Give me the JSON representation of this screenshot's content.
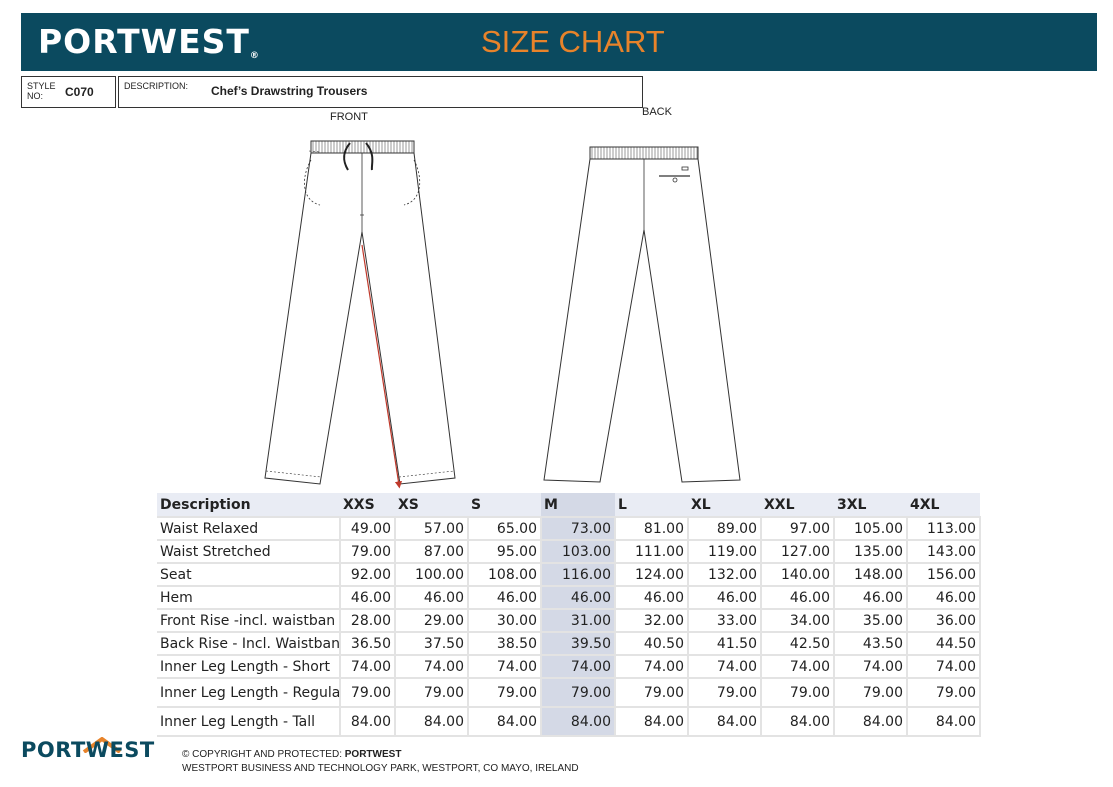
{
  "header": {
    "brand": "PORTWEST",
    "brand_mark": "®",
    "title": "SIZE CHART"
  },
  "style": {
    "label": "STYLE NO:",
    "value": "C070"
  },
  "description": {
    "label": "DESCRIPTION:",
    "value": "Chef’s Drawstring Trousers"
  },
  "views": {
    "front_label": "FRONT",
    "back_label": "BACK"
  },
  "table": {
    "headers": [
      "Description",
      "XXS",
      "XS",
      "S",
      "M",
      "L",
      "XL",
      "XXL",
      "3XL",
      "4XL"
    ],
    "rows": [
      {
        "label": "Waist Relaxed",
        "values": [
          "49.00",
          "57.00",
          "65.00",
          "73.00",
          "81.00",
          "89.00",
          "97.00",
          "105.00",
          "113.00"
        ]
      },
      {
        "label": "Waist Stretched",
        "values": [
          "79.00",
          "87.00",
          "95.00",
          "103.00",
          "111.00",
          "119.00",
          "127.00",
          "135.00",
          "143.00"
        ]
      },
      {
        "label": "Seat",
        "values": [
          "92.00",
          "100.00",
          "108.00",
          "116.00",
          "124.00",
          "132.00",
          "140.00",
          "148.00",
          "156.00"
        ]
      },
      {
        "label": "Hem",
        "values": [
          "46.00",
          "46.00",
          "46.00",
          "46.00",
          "46.00",
          "46.00",
          "46.00",
          "46.00",
          "46.00"
        ]
      },
      {
        "label": "Front Rise -incl. waistban",
        "values": [
          "28.00",
          "29.00",
          "30.00",
          "31.00",
          "32.00",
          "33.00",
          "34.00",
          "35.00",
          "36.00"
        ]
      },
      {
        "label": "Back Rise - Incl. Waistban",
        "values": [
          "36.50",
          "37.50",
          "38.50",
          "39.50",
          "40.50",
          "41.50",
          "42.50",
          "43.50",
          "44.50"
        ]
      },
      {
        "label": "Inner Leg Length - Short",
        "values": [
          "74.00",
          "74.00",
          "74.00",
          "74.00",
          "74.00",
          "74.00",
          "74.00",
          "74.00",
          "74.00"
        ]
      },
      {
        "label": "Inner Leg Length - Regula",
        "values": [
          "79.00",
          "79.00",
          "79.00",
          "79.00",
          "79.00",
          "79.00",
          "79.00",
          "79.00",
          "79.00"
        ]
      },
      {
        "label": "Inner Leg Length - Tall",
        "values": [
          "84.00",
          "84.00",
          "84.00",
          "84.00",
          "84.00",
          "84.00",
          "84.00",
          "84.00",
          "84.00"
        ]
      }
    ]
  },
  "footer": {
    "logo": "PORTWEST",
    "copyright_prefix": "© COPYRIGHT AND PROTECTED: ",
    "copyright_brand": "PORTWEST",
    "address": "WESTPORT BUSINESS AND TECHNOLOGY PARK, WESTPORT, CO MAYO, IRELAND"
  },
  "colors": {
    "header_bg": "#0b4a5f",
    "title": "#e8832a",
    "highlight_col": "#d4d9e6",
    "measure_arrow": "#c0392b"
  }
}
